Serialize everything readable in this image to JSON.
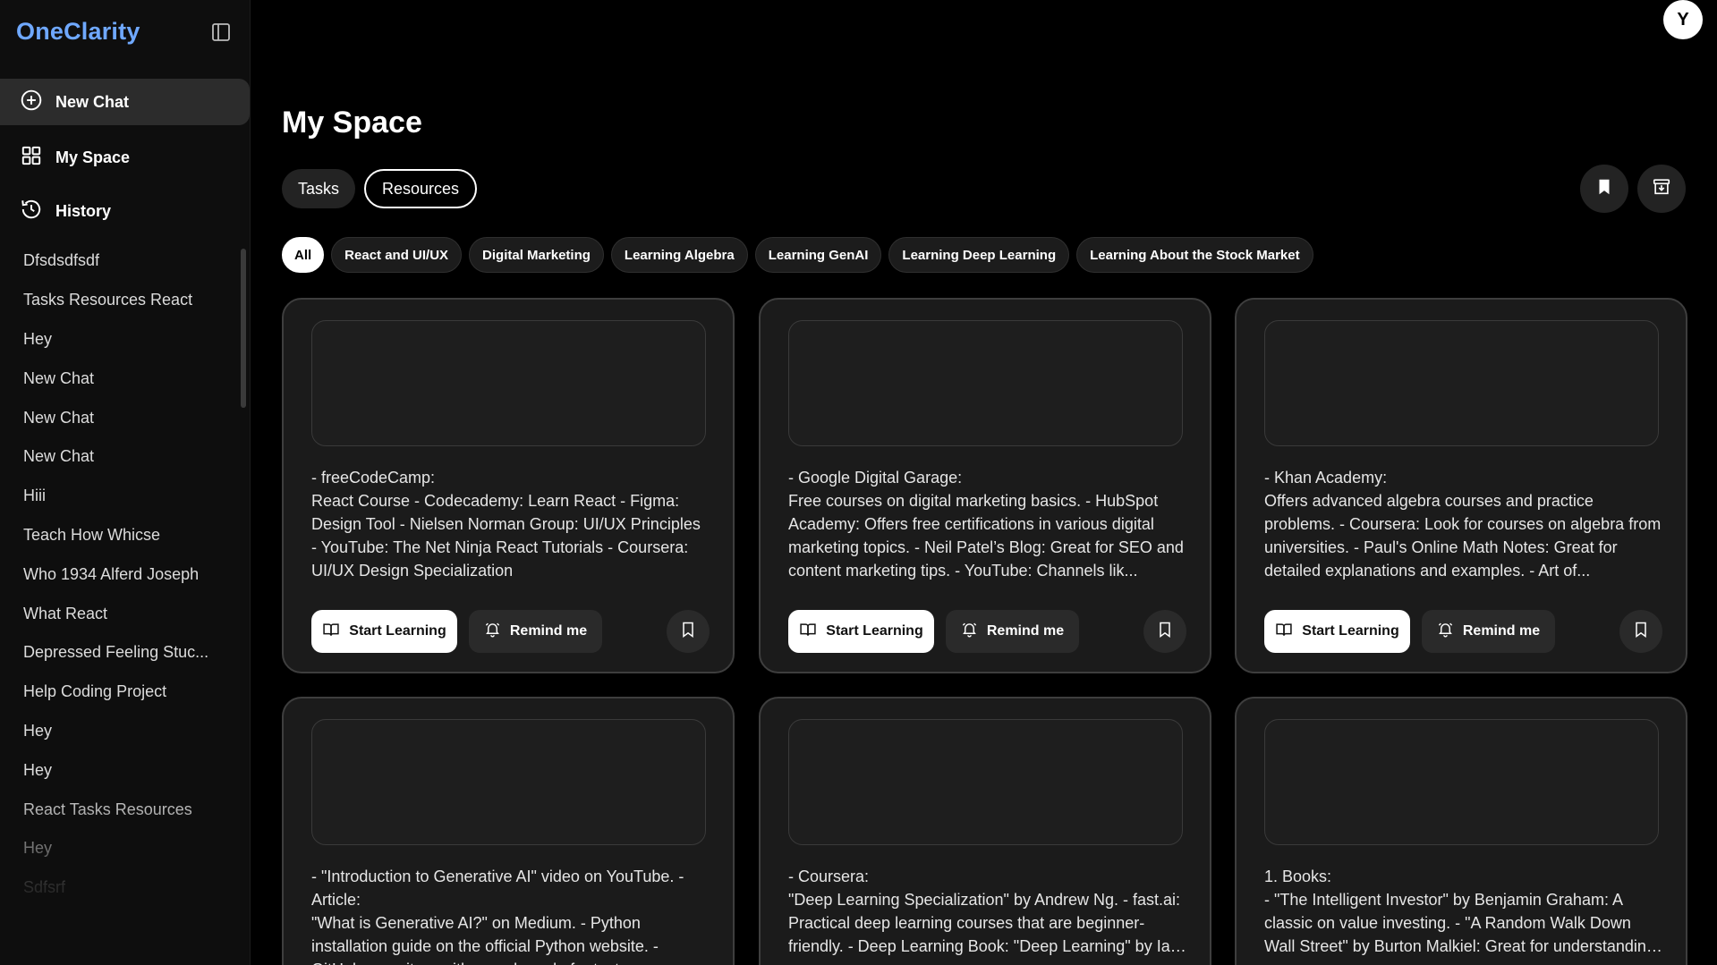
{
  "app": {
    "brand": "OneClarity",
    "avatar_initial": "Y"
  },
  "nav": {
    "new_chat": "New Chat",
    "my_space": "My Space",
    "history": "History"
  },
  "history_items": [
    "Dfsdsdfsdf",
    "Tasks Resources React",
    "Hey",
    "New Chat",
    "New Chat",
    "New Chat",
    "Hiii",
    "Teach How Whicse",
    "Who 1934 Alferd Joseph",
    "What React",
    "Depressed Feeling Stuc...",
    "Help Coding Project",
    "Hey",
    "Hey",
    "React Tasks Resources",
    "Hey",
    "Sdfsrf"
  ],
  "main": {
    "title": "My Space",
    "tabs": [
      {
        "label": "Tasks",
        "active": false
      },
      {
        "label": "Resources",
        "active": true
      }
    ],
    "filters": [
      {
        "label": "All",
        "active": true
      },
      {
        "label": "React and UI/UX",
        "active": false
      },
      {
        "label": "Digital Marketing",
        "active": false
      },
      {
        "label": "Learning Algebra",
        "active": false
      },
      {
        "label": "Learning GenAI",
        "active": false
      },
      {
        "label": "Learning Deep Learning",
        "active": false
      },
      {
        "label": "Learning About the Stock Market",
        "active": false
      }
    ],
    "cards": [
      {
        "source": "- freeCodeCamp:",
        "desc": "React Course - Codecademy: Learn React - Figma: Design Tool - Nielsen Norman Group: UI/UX Principles - YouTube: The Net Ninja React Tutorials - Coursera: UI/UX Design Specialization"
      },
      {
        "source": "- Google Digital Garage:",
        "desc": "Free courses on digital marketing basics. - HubSpot Academy: Offers free certifications in various digital marketing topics. - Neil Patel’s Blog: Great for SEO and content marketing tips. - YouTube: Channels lik..."
      },
      {
        "source": "- Khan Academy:",
        "desc": "Offers advanced algebra courses and practice problems. - Coursera: Look for courses on algebra from universities. - Paul's Online Math Notes: Great for detailed explanations and examples. - Art of..."
      },
      {
        "source": "- \"Introduction to Generative AI\" video on YouTube. - Article:",
        "desc": "\"What is Generative AI?\" on Medium. - Python installation guide on the official Python website. - GitHub repository with sample code for text..."
      },
      {
        "source": "- Coursera:",
        "desc": "\"Deep Learning Specialization\" by Andrew Ng. - fast.ai: Practical deep learning courses that are beginner-friendly. - Deep Learning Book: \"Deep Learning\" by Ian Goodfellow..."
      },
      {
        "source": "1. Books:",
        "desc": "- \"The Intelligent Investor\" by Benjamin Graham: A classic on value investing. - \"A Random Walk Down Wall Street\" by Burton Malkiel: Great for understanding market theories."
      }
    ],
    "buttons": {
      "start": "Start Learning",
      "remind": "Remind me"
    }
  }
}
